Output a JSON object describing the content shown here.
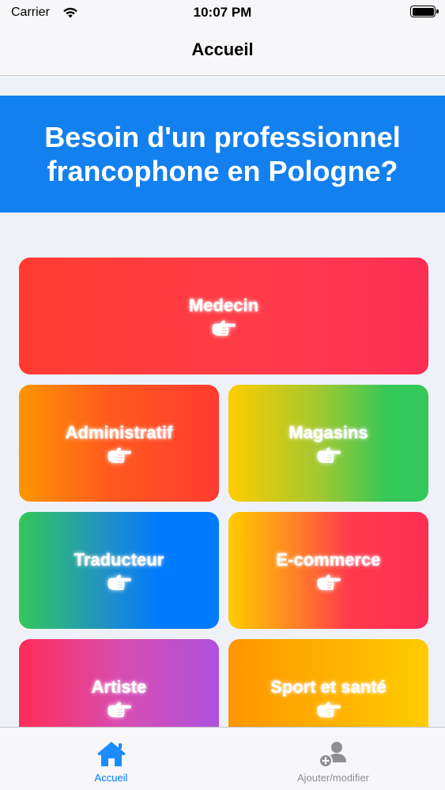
{
  "status_bar": {
    "carrier": "Carrier",
    "time": "10:07 PM"
  },
  "nav": {
    "title": "Accueil"
  },
  "banner": {
    "text": "Besoin d'un professionnel francophone en Pologne?",
    "color": "#1380f0"
  },
  "categories": [
    {
      "label": "Medecin",
      "icon": "pointing-hand-icon"
    },
    {
      "label": "Administratif",
      "icon": "pointing-hand-icon"
    },
    {
      "label": "Magasins",
      "icon": "pointing-hand-icon"
    },
    {
      "label": "Traducteur",
      "icon": "pointing-hand-icon"
    },
    {
      "label": "E-commerce",
      "icon": "pointing-hand-icon"
    },
    {
      "label": "Artiste",
      "icon": "pointing-hand-icon"
    },
    {
      "label": "Sport et santé",
      "icon": "pointing-hand-icon"
    }
  ],
  "tab_bar": {
    "items": [
      {
        "label": "Accueil",
        "icon": "house-icon",
        "active": true,
        "color": "#007aff"
      },
      {
        "label": "Ajouter/modifier",
        "icon": "add-person-icon",
        "active": false,
        "color": "#8e8e93"
      }
    ]
  }
}
